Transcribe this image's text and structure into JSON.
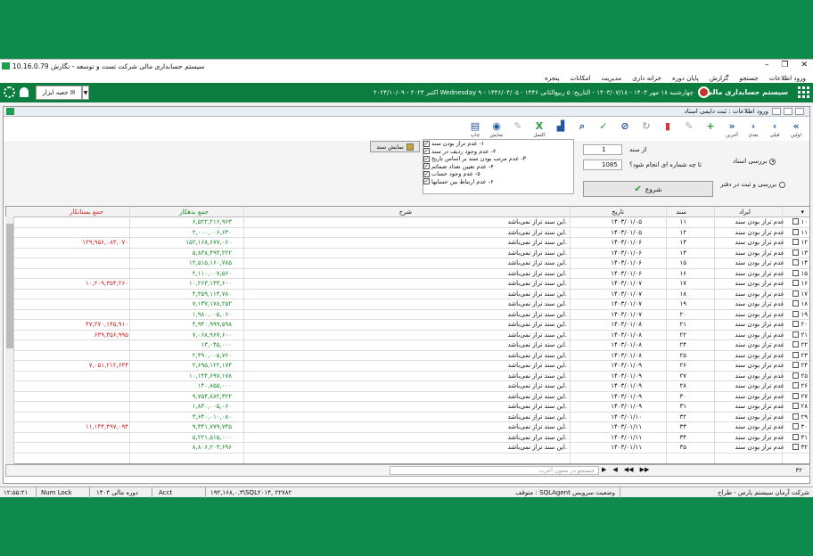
{
  "window": {
    "title": "سیستم حسابداری مالی شرکت تست و توسعه - نگارش 10.16.0.79"
  },
  "menu": [
    "ورود اطلاعات",
    "جستجو",
    "گزارش",
    "پایان دوره",
    "خزانه داری",
    "مدیریت",
    "امکانات",
    "پنجره"
  ],
  "topbar": {
    "system": "سیستم حسابداری مالی",
    "date": "چهارشنبه ۱۸ مهر ۱۴۰۳ - ۱۴۰۳/۰۷/۱۸ - التاریخ: ۵ ربیع‌الثانی ۱۴۴۶ - ۱۴۴۶/۰۴/۰۵ - Wednesday ۹ اکتبر ۲۰۲۴ - ۲۰۲۴/۱۰/۰۹",
    "tools_label": "جعبه ابزار"
  },
  "child": {
    "title": "ورود اطلاعات : ثبت دایمی اسناد"
  },
  "toolbar": [
    {
      "label": "اولین",
      "icon": "first-icon",
      "glyph": "«",
      "style": "blue"
    },
    {
      "label": "قبلی",
      "icon": "prev-icon",
      "glyph": "‹",
      "style": "blue"
    },
    {
      "label": "بعدی",
      "icon": "next-icon",
      "glyph": "›",
      "style": "blue"
    },
    {
      "label": "آخرین",
      "icon": "last-icon",
      "glyph": "»",
      "style": "blue"
    },
    {
      "label": "",
      "icon": "add-icon",
      "glyph": "+",
      "style": "green dis"
    },
    {
      "label": "",
      "icon": "edit-icon",
      "glyph": "✎",
      "style": "dis"
    },
    {
      "label": "",
      "icon": "delete-icon",
      "glyph": "▮",
      "style": "red dis"
    },
    {
      "label": "",
      "icon": "refresh-icon",
      "glyph": "↻",
      "style": "dis"
    },
    {
      "label": "",
      "icon": "cancel-icon",
      "glyph": "⊘",
      "style": "blue dis"
    },
    {
      "label": "",
      "icon": "confirm-icon",
      "glyph": "✓",
      "style": "green dis"
    },
    {
      "label": "",
      "icon": "search-icon",
      "glyph": "⌕",
      "style": "blue dis"
    },
    {
      "label": "",
      "icon": "chart-icon",
      "glyph": "▟",
      "style": "blue"
    },
    {
      "label": "اکسل",
      "icon": "excel-icon",
      "glyph": "X",
      "style": "green"
    },
    {
      "label": "",
      "icon": "pen-icon",
      "glyph": "✎",
      "style": "dis"
    },
    {
      "label": "نمایش",
      "icon": "view-icon",
      "glyph": "◉",
      "style": "blue"
    },
    {
      "label": "چاپ",
      "icon": "print-icon",
      "glyph": "▤",
      "style": "blue"
    }
  ],
  "panel": {
    "radio1": "بررسی اسناد",
    "radio2": "بررسی و ثبت در دفتر",
    "from_label": "از سند",
    "from_value": "1",
    "to_label": "تا چه شماره ای انجام شود؟",
    "to_value": "1085",
    "start": "شروع",
    "show_doc": "نمایش سند",
    "checks": [
      "۱- عدم تراز بودن سند",
      "۲- عدم وجود ردیف در سند",
      "۳- عدم مرتب بودن سند بر اساس تاریخ",
      "۴- عدم تعیین تعداد ضمائم",
      "۵- عدم وجود حساب",
      "۶- عدم ارتباط بین حسابها"
    ]
  },
  "table": {
    "headers": {
      "err": "ایراد",
      "doc": "سند",
      "date": "تاریخ",
      "desc": "شرح",
      "deb": "جمع بدهکار",
      "cre": "جمع بستانکار"
    },
    "rows": [
      {
        "n": "۱۰",
        "err": "عدم تراز بودن سند",
        "doc": "۱۱",
        "date": "۱۴۰۳/۰۱/۰۵",
        "desc": "این سند تراز نمی‌باشد.",
        "deb": "۶,۵۲۲,۲۱۶,۹۶۳",
        "cre": ""
      },
      {
        "n": "۱۱",
        "err": "عدم تراز بودن سند",
        "doc": "۱۲",
        "date": "۱۴۰۳/۰۱/۰۵",
        "desc": "این سند تراز نمی‌باشد.",
        "deb": "۲,۰۰۰,۰۰۶,۶۴۰",
        "cre": ""
      },
      {
        "n": "۱۲",
        "err": "عدم تراز بودن سند",
        "doc": "۱۳",
        "date": "۱۴۰۳/۰۱/۰۶",
        "desc": "این سند تراز نمی‌باشد.",
        "deb": "۱۵۲,۱۶۸,۶۷۷,۰۶۰",
        "cre": "۱۲۹,۹۵۶,۰۸۳,۰۷۰"
      },
      {
        "n": "۱۳",
        "err": "عدم تراز بودن سند",
        "doc": "۱۴",
        "date": "۱۴۰۳/۰۱/۰۶",
        "desc": "این سند تراز نمی‌باشد.",
        "deb": "۵,۸۳۸,۴۹۴,۲۲۲",
        "cre": ""
      },
      {
        "n": "۱۴",
        "err": "عدم تراز بودن سند",
        "doc": "۱۵",
        "date": "۱۴۰۳/۰۱/۰۶",
        "desc": "این سند تراز نمی‌باشد.",
        "deb": "۱۲,۵۱۵,۱۶۰,۷۸۵",
        "cre": ""
      },
      {
        "n": "۱۵",
        "err": "عدم تراز بودن سند",
        "doc": "۱۶",
        "date": "۱۴۰۳/۰۱/۰۶",
        "desc": "این سند تراز نمی‌باشد.",
        "deb": "۲,۱۱۰,۰۰۷,۵۶۰",
        "cre": ""
      },
      {
        "n": "۱۶",
        "err": "عدم تراز بودن سند",
        "doc": "۱۷",
        "date": "۱۴۰۳/۰۱/۰۷",
        "desc": "این سند تراز نمی‌باشد.",
        "deb": "۱۰,۲۶۳,۱۳۳,۶۰۰",
        "cre": "۱۰,۲۰۹,۳۵۴,۲۶۰"
      },
      {
        "n": "۱۷",
        "err": "عدم تراز بودن سند",
        "doc": "۱۸",
        "date": "۱۴۰۳/۰۱/۰۷",
        "desc": "این سند تراز نمی‌باشد.",
        "deb": "۴,۳۵۹,۱۱۴,۷۸۰",
        "cre": ""
      },
      {
        "n": "۱۸",
        "err": "عدم تراز بودن سند",
        "doc": "۱۹",
        "date": "۱۴۰۳/۰۱/۰۷",
        "desc": "این سند تراز نمی‌باشد.",
        "deb": "۷,۱۳۷,۱۷۸,۲۵۲",
        "cre": ""
      },
      {
        "n": "۱۹",
        "err": "عدم تراز بودن سند",
        "doc": "۲۰",
        "date": "۱۴۰۳/۰۱/۰۷",
        "desc": "این سند تراز نمی‌باشد.",
        "deb": "۱,۹۸۰,۰۰۵,۰۶۰",
        "cre": ""
      },
      {
        "n": "۲۰",
        "err": "عدم تراز بودن سند",
        "doc": "۲۱",
        "date": "۱۴۰۳/۰۱/۰۸",
        "desc": "این سند تراز نمی‌باشد.",
        "deb": "۴,۹۴۰,۹۹۹,۵۹۸",
        "cre": "۴۷,۲۷۰,۱۴۵,۹۱۰"
      },
      {
        "n": "۲۱",
        "err": "عدم تراز بودن سند",
        "doc": "۲۲",
        "date": "۱۴۰۳/۰۱/۰۸",
        "desc": "این سند تراز نمی‌باشد.",
        "deb": "۷,۰۶۸,۹۶۷,۶۰۰",
        "cre": "۶۳۹,۳۵۶,۹۹۵"
      },
      {
        "n": "۲۲",
        "err": "عدم تراز بودن سند",
        "doc": "۲۴",
        "date": "۱۴۰۳/۰۱/۰۸",
        "desc": "این سند تراز نمی‌باشد.",
        "deb": "۱۳,۰۴۵,۰۰۰",
        "cre": ""
      },
      {
        "n": "۲۳",
        "err": "عدم تراز بودن سند",
        "doc": "۲۵",
        "date": "۱۴۰۳/۰۱/۰۸",
        "desc": "این سند تراز نمی‌باشد.",
        "deb": "۲,۴۹۰,۰۰۵,۷۶۰",
        "cre": ""
      },
      {
        "n": "۲۴",
        "err": "عدم تراز بودن سند",
        "doc": "۲۶",
        "date": "۱۴۰۳/۰۱/۰۹",
        "desc": "این سند تراز نمی‌باشد.",
        "deb": "۲,۶۹۵,۱۲۲,۱۷۴",
        "cre": "۷,۰۵۱,۲۱۲,۶۳۳"
      },
      {
        "n": "۲۵",
        "err": "عدم تراز بودن سند",
        "doc": "۲۷",
        "date": "۱۴۰۳/۰۱/۰۹",
        "desc": "این سند تراز نمی‌باشد.",
        "deb": "۱۰,۱۴۴,۶۹۷,۱۷۸",
        "cre": ""
      },
      {
        "n": "۲۶",
        "err": "عدم تراز بودن سند",
        "doc": "۲۸",
        "date": "۱۴۰۳/۰۱/۰۹",
        "desc": "این سند تراز نمی‌باشد.",
        "deb": "۱۴۰,۸۵۵,۰۰۰",
        "cre": ""
      },
      {
        "n": "۲۷",
        "err": "عدم تراز بودن سند",
        "doc": "۳۰",
        "date": "۱۴۰۳/۰۱/۰۹",
        "desc": "این سند تراز نمی‌باشد.",
        "deb": "۹,۷۵۴,۸۸۲,۴۲۲",
        "cre": ""
      },
      {
        "n": "۲۸",
        "err": "عدم تراز بودن سند",
        "doc": "۳۱",
        "date": "۱۴۰۳/۰۱/۰۹",
        "desc": "این سند تراز نمی‌باشد.",
        "deb": "۱,۸۴۰,۰۰۵,۰۶۰",
        "cre": ""
      },
      {
        "n": "۲۹",
        "err": "عدم تراز بودن سند",
        "doc": "۳۲",
        "date": "۱۴۰۳/۰۱/۱۰",
        "desc": "این سند تراز نمی‌باشد.",
        "deb": "۳,۶۴۰,۰۱۰,۰۸۰",
        "cre": ""
      },
      {
        "n": "۳۰",
        "err": "عدم تراز بودن سند",
        "doc": "۳۳",
        "date": "۱۴۰۳/۰۱/۱۱",
        "desc": "این سند تراز نمی‌باشد.",
        "deb": "۹,۴۴۱,۷۷۹,۷۴۵",
        "cre": "۱۱,۱۴۴,۴۹۷,۰۹۴"
      },
      {
        "n": "۳۱",
        "err": "عدم تراز بودن سند",
        "doc": "۳۴",
        "date": "۱۴۰۳/۰۱/۱۱",
        "desc": "این سند تراز نمی‌باشد.",
        "deb": "۵,۲۲۱,۵۱۵,۰۰۰",
        "cre": ""
      },
      {
        "n": "۳۲",
        "err": "عدم تراز بودن سند",
        "doc": "۳۵",
        "date": "۱۴۰۳/۰۱/۱۱",
        "desc": "این سند تراز نمی‌باشد.",
        "deb": "۸,۸۰۶,۲۰۳,۶۹۶",
        "cre": ""
      }
    ]
  },
  "footer": {
    "count": "۳۲",
    "filter_placeholder": "جستجو در ستون آخرت",
    "navs": [
      "▶",
      "◀",
      "◀◀",
      "▶▶"
    ]
  },
  "status": {
    "company": "شرکت آرمان سیستم پارس - طراح",
    "service": "متوقف : SQLAgent وضعیت سرویس",
    "server": "۱۹۲,۱۶۸,۰,۳\\SQL۲۰۱۴, ۲۲۷۸۲",
    "user": "Acct",
    "period": "دوره مالی ۱۴۰۳",
    "numlock": "Num Lock",
    "time": "۱۲:۵۵:۲۱"
  }
}
